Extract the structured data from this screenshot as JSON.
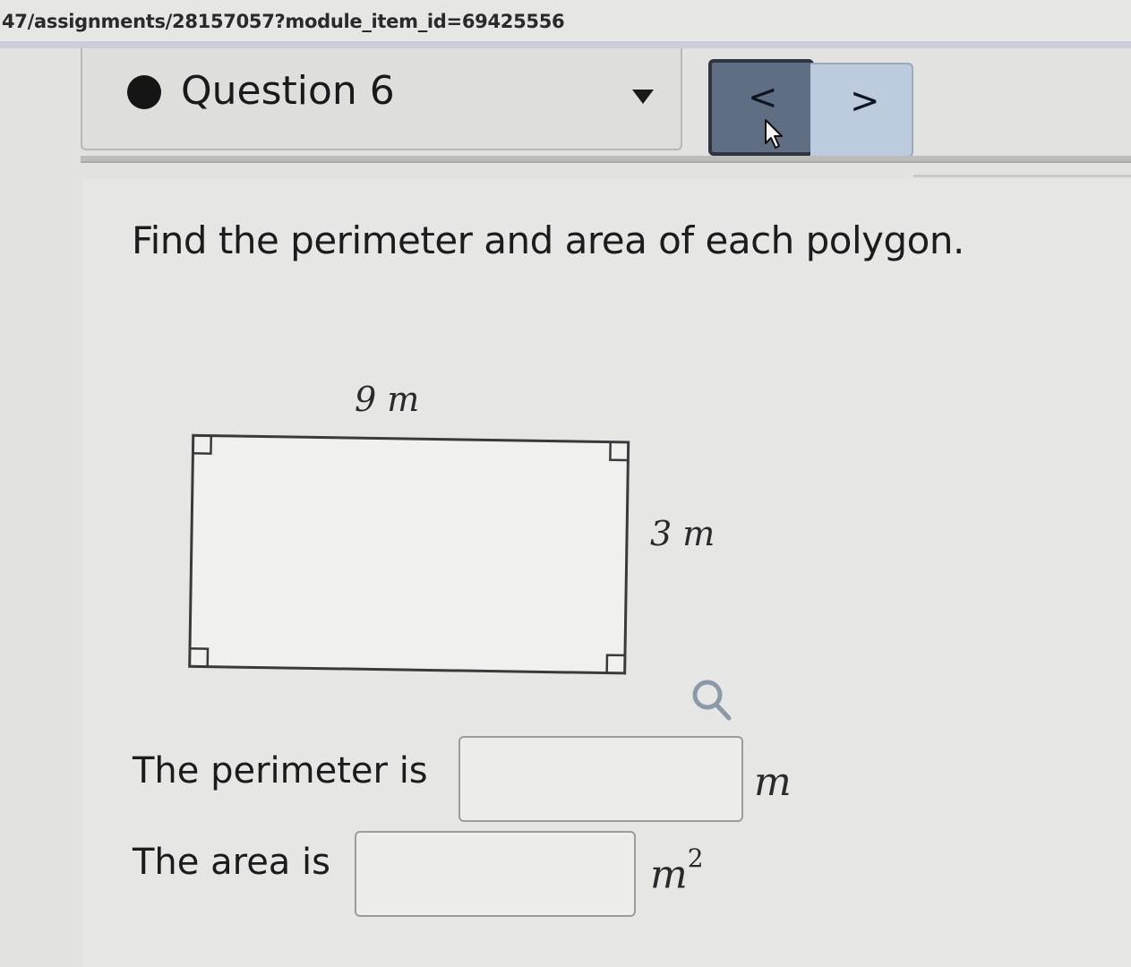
{
  "browser": {
    "url": "47/assignments/28157057?module_item_id=69425556"
  },
  "question_nav": {
    "label": "Question 6",
    "status": "answered-dot",
    "prev_label": "<",
    "next_label": ">"
  },
  "problem": {
    "prompt": "Find the perimeter and area of each polygon.",
    "figure": {
      "shape": "rectangle",
      "top_label": "9 m",
      "side_label": "3 m"
    },
    "perimeter": {
      "label": "The perimeter is",
      "value": "",
      "unit": "m"
    },
    "area": {
      "label": "The area is",
      "value": "",
      "unit": "m",
      "unit_exponent": "2"
    }
  },
  "icons": {
    "dropdown": "caret-down-icon",
    "prev": "chevron-left-icon",
    "next": "chevron-right-icon",
    "cursor": "mouse-pointer-icon",
    "zoom": "magnifier-icon"
  },
  "colors": {
    "prev_button": "#5f6e82",
    "next_button": "#bccbde",
    "page_background": "#e6e6e4"
  }
}
